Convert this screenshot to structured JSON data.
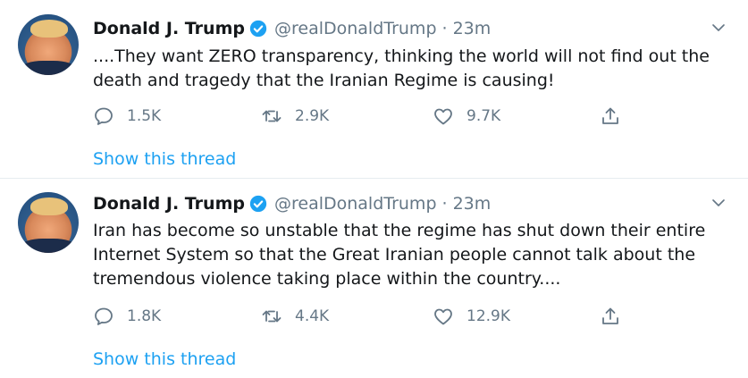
{
  "tweets": [
    {
      "author_name": "Donald J. Trump",
      "handle": "@realDonaldTrump",
      "separator": "·",
      "time": "23m",
      "text": "....They want ZERO transparency, thinking the world will not find out the death and tragedy that the Iranian Regime is causing!",
      "replies": "1.5K",
      "retweets": "2.9K",
      "likes": "9.7K",
      "thread_link": "Show this thread"
    },
    {
      "author_name": "Donald J. Trump",
      "handle": "@realDonaldTrump",
      "separator": "·",
      "time": "23m",
      "text": "Iran has become so unstable that the regime has shut down their entire Internet System so that the Great Iranian people cannot talk about the tremendous violence taking place within the country....",
      "replies": "1.8K",
      "retweets": "4.4K",
      "likes": "12.9K",
      "thread_link": "Show this thread"
    }
  ],
  "icons": {
    "verified": "verified-badge-icon",
    "caret": "chevron-down-icon",
    "reply": "reply-icon",
    "retweet": "retweet-icon",
    "like": "heart-icon",
    "share": "share-icon"
  },
  "colors": {
    "link": "#1da1f2",
    "secondary_text": "#657786",
    "primary_text": "#14171a",
    "verified": "#1da1f2",
    "divider": "#e6ecf0"
  }
}
